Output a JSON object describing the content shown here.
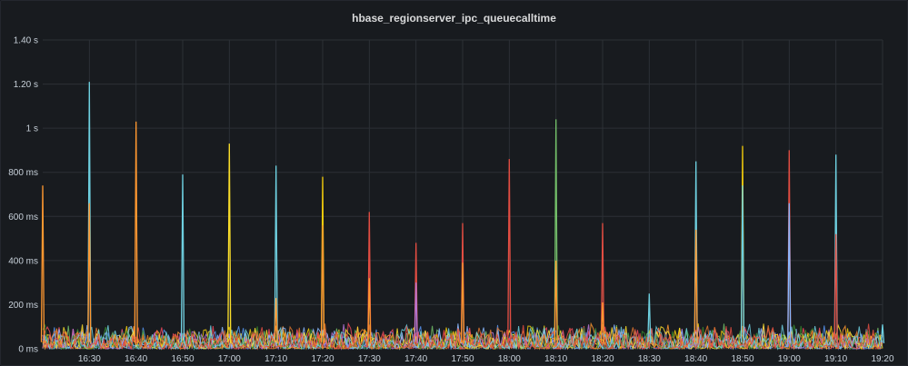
{
  "panel": {
    "title": "hbase_regionserver_ipc_queuecalltime"
  },
  "chart_data": {
    "type": "line",
    "title": "hbase_regionserver_ipc_queuecalltime",
    "xlabel": "",
    "ylabel": "",
    "y_unit": "ms",
    "ylim": [
      0,
      1400
    ],
    "y_ticks": [
      0,
      200,
      400,
      600,
      800,
      1000,
      1200,
      1400
    ],
    "y_tick_labels": [
      "0 ms",
      "200 ms",
      "400 ms",
      "600 ms",
      "800 ms",
      "1 s",
      "1.20 s",
      "1.40 s"
    ],
    "xlim": [
      "16:20",
      "19:20"
    ],
    "x_ticks": [
      "16:30",
      "16:40",
      "16:50",
      "17:00",
      "17:10",
      "17:20",
      "17:30",
      "17:40",
      "17:50",
      "18:00",
      "18:10",
      "18:20",
      "18:30",
      "18:40",
      "18:50",
      "19:00",
      "19:10",
      "19:20"
    ],
    "grid": true,
    "legend": "none",
    "series_colors": [
      "#73bf69",
      "#f2cc0c",
      "#5794f2",
      "#ff9830",
      "#f2495c",
      "#b877d9",
      "#8ab8ff",
      "#fade2a",
      "#37872d",
      "#e0752d",
      "#6ed0e0",
      "#e24d42"
    ],
    "spikes": [
      {
        "time": "16:20",
        "value": 740,
        "color": "#ff9830"
      },
      {
        "time": "16:30",
        "value": 1210,
        "color": "#6ed0e0"
      },
      {
        "time": "16:30",
        "value": 660,
        "color": "#ff9830"
      },
      {
        "time": "16:40",
        "value": 1030,
        "color": "#ff9830"
      },
      {
        "time": "16:50",
        "value": 790,
        "color": "#6ed0e0"
      },
      {
        "time": "17:00",
        "value": 930,
        "color": "#fade2a"
      },
      {
        "time": "17:10",
        "value": 830,
        "color": "#6ed0e0"
      },
      {
        "time": "17:10",
        "value": 230,
        "color": "#ff9830"
      },
      {
        "time": "17:20",
        "value": 780,
        "color": "#f2cc0c"
      },
      {
        "time": "17:20",
        "value": 560,
        "color": "#ff9830"
      },
      {
        "time": "17:30",
        "value": 620,
        "color": "#e24d42"
      },
      {
        "time": "17:30",
        "value": 320,
        "color": "#ff9830"
      },
      {
        "time": "17:40",
        "value": 480,
        "color": "#e24d42"
      },
      {
        "time": "17:40",
        "value": 300,
        "color": "#b877d9"
      },
      {
        "time": "17:50",
        "value": 570,
        "color": "#e24d42"
      },
      {
        "time": "17:50",
        "value": 390,
        "color": "#ff9830"
      },
      {
        "time": "18:00",
        "value": 860,
        "color": "#e24d42"
      },
      {
        "time": "18:10",
        "value": 1040,
        "color": "#73bf69"
      },
      {
        "time": "18:10",
        "value": 400,
        "color": "#ff9830"
      },
      {
        "time": "18:20",
        "value": 570,
        "color": "#e24d42"
      },
      {
        "time": "18:20",
        "value": 210,
        "color": "#ff9830"
      },
      {
        "time": "18:30",
        "value": 250,
        "color": "#6ed0e0"
      },
      {
        "time": "18:40",
        "value": 850,
        "color": "#6ed0e0"
      },
      {
        "time": "18:40",
        "value": 540,
        "color": "#ff9830"
      },
      {
        "time": "18:50",
        "value": 920,
        "color": "#f2cc0c"
      },
      {
        "time": "18:50",
        "value": 740,
        "color": "#6ed0e0"
      },
      {
        "time": "19:00",
        "value": 900,
        "color": "#e24d42"
      },
      {
        "time": "19:00",
        "value": 660,
        "color": "#8ab8ff"
      },
      {
        "time": "19:10",
        "value": 880,
        "color": "#6ed0e0"
      },
      {
        "time": "19:10",
        "value": 520,
        "color": "#e24d42"
      },
      {
        "time": "19:20",
        "value": 110,
        "color": "#6ed0e0"
      }
    ],
    "baseline_range": [
      0,
      120
    ]
  }
}
